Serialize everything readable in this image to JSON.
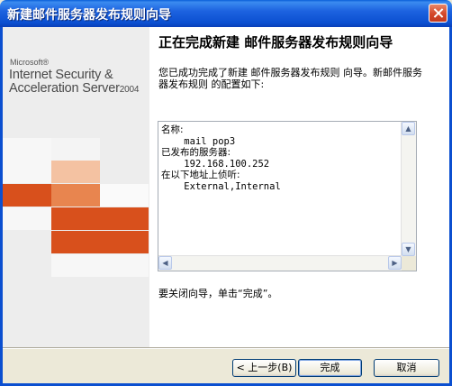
{
  "window": {
    "title": "新建邮件服务器发布规则向导"
  },
  "banner": {
    "brand_small": "Microsoft®",
    "product_line1": "Internet Security &",
    "product_line2_main": "Acceleration Server",
    "product_line2_year": "2004",
    "colors": {
      "orange_dark": "#d8501c",
      "orange_mid": "#e8854f",
      "orange_light": "#f4c2a2",
      "tile_gray": "#f7f7f7",
      "background": "#ededed"
    }
  },
  "main": {
    "heading": "正在完成新建 邮件服务器发布规则向导",
    "intro": "您已成功完成了新建 邮件服务器发布规则 向导。新邮件服务器发布规则 的配置如下:",
    "summary": {
      "name_label": "名称:",
      "name_value": "mail pop3",
      "servers_label": "已发布的服务器:",
      "servers_value": "192.168.100.252",
      "listen_label": "在以下地址上侦听:",
      "listen_value": "External,Internal"
    },
    "close_hint": "要关闭向导，单击“完成”。"
  },
  "buttons": {
    "back": "< 上一步(B)",
    "finish": "完成",
    "cancel": "取消"
  }
}
